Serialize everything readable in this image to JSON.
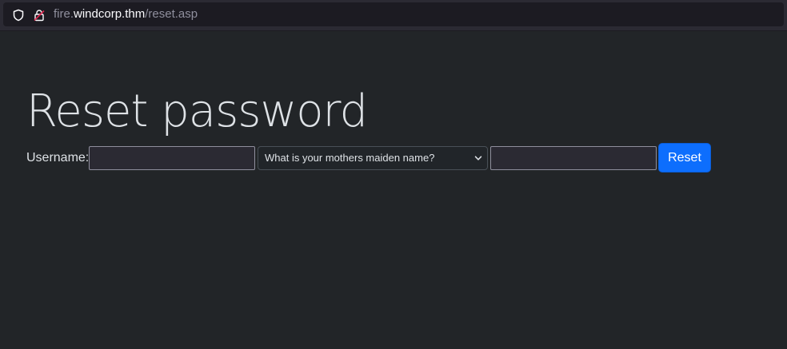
{
  "browser": {
    "url_host_prefix": "fire.",
    "url_host_main": "windcorp.thm",
    "url_path": "/reset.asp"
  },
  "page": {
    "title": "Reset password"
  },
  "form": {
    "username_label": "Username:",
    "username_value": "",
    "question_selected": "What is your mothers maiden name?",
    "answer_value": "",
    "reset_label": "Reset"
  },
  "colors": {
    "background": "#222528",
    "button": "#0d6efd",
    "text": "#dee2e6"
  },
  "icons": {
    "shield": "shield-icon",
    "lock": "lock-icon",
    "dropdown": "chevron-down-icon"
  }
}
